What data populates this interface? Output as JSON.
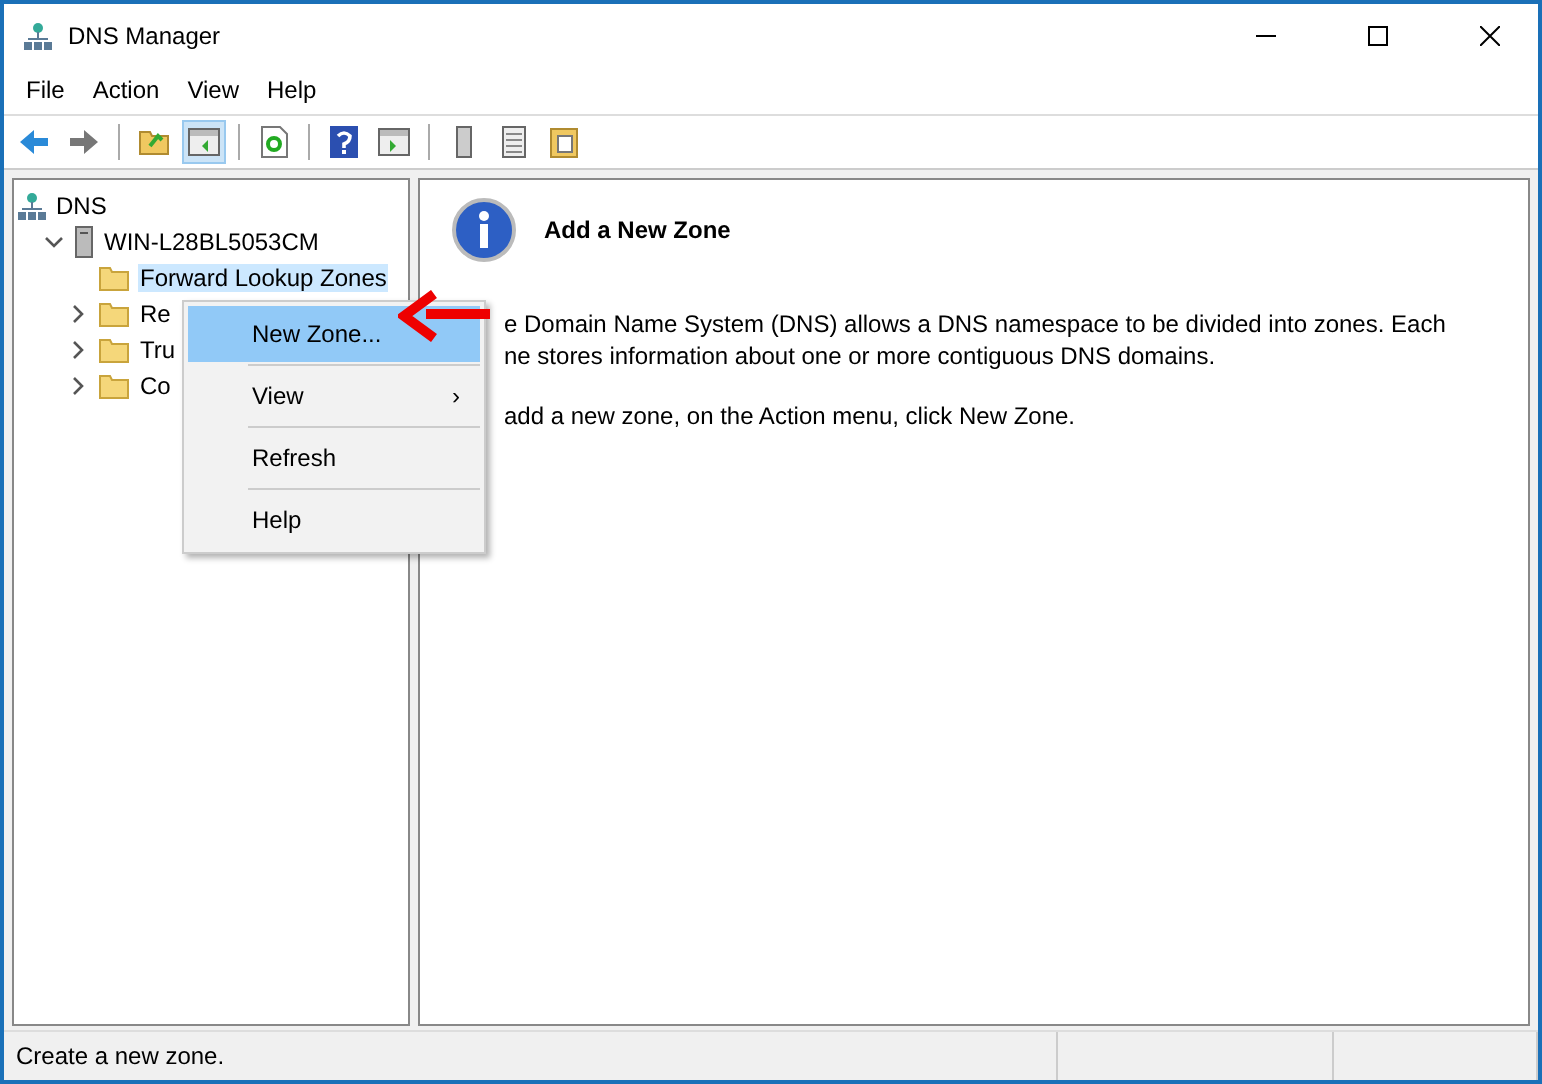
{
  "window": {
    "title": "DNS Manager"
  },
  "menu_bar": [
    {
      "label": "File"
    },
    {
      "label": "Action"
    },
    {
      "label": "View"
    },
    {
      "label": "Help"
    }
  ],
  "toolbar": [
    {
      "kind": "back",
      "selected": false
    },
    {
      "kind": "forward",
      "selected": false
    },
    {
      "kind": "sep"
    },
    {
      "kind": "up",
      "selected": false
    },
    {
      "kind": "tree",
      "selected": true
    },
    {
      "kind": "sep"
    },
    {
      "kind": "refresh",
      "selected": false
    },
    {
      "kind": "sep"
    },
    {
      "kind": "help",
      "selected": false
    },
    {
      "kind": "pane",
      "selected": false
    },
    {
      "kind": "sep"
    },
    {
      "kind": "server",
      "selected": false
    },
    {
      "kind": "list",
      "selected": false
    },
    {
      "kind": "export",
      "selected": false
    }
  ],
  "tree": [
    {
      "label": "DNS",
      "kind": "root",
      "selected": false,
      "children": [
        {
          "label": "WIN-L28BL5053CM",
          "kind": "server",
          "expanded": true,
          "selected": false,
          "children": [
            {
              "label": "Forward Lookup Zones",
              "kind": "folder",
              "selected": true
            },
            {
              "label": "Re",
              "kind": "folder",
              "expanded": false,
              "selected": false
            },
            {
              "label": "Tru",
              "kind": "folder",
              "expanded": false,
              "selected": false
            },
            {
              "label": "Co",
              "kind": "folder",
              "expanded": false,
              "selected": false
            }
          ]
        }
      ]
    }
  ],
  "context_menu": [
    {
      "kind": "item",
      "label": "New Zone...",
      "selected": true
    },
    {
      "kind": "submenu",
      "label": "View",
      "arrow": "›",
      "selected": false
    },
    {
      "kind": "item",
      "label": "Refresh",
      "selected": false
    },
    {
      "kind": "item",
      "label": "Help",
      "selected": false
    }
  ],
  "content": {
    "title": "Add a New Zone",
    "paragraphs": [
      [
        "e Domain Name System (DNS) allows a DNS namespace to be divided into zones. Each",
        "ne stores information about one or more contiguous DNS domains."
      ],
      [
        "add a new zone, on the Action menu, click New Zone."
      ]
    ]
  },
  "status_bar": [
    "Create a new zone."
  ]
}
